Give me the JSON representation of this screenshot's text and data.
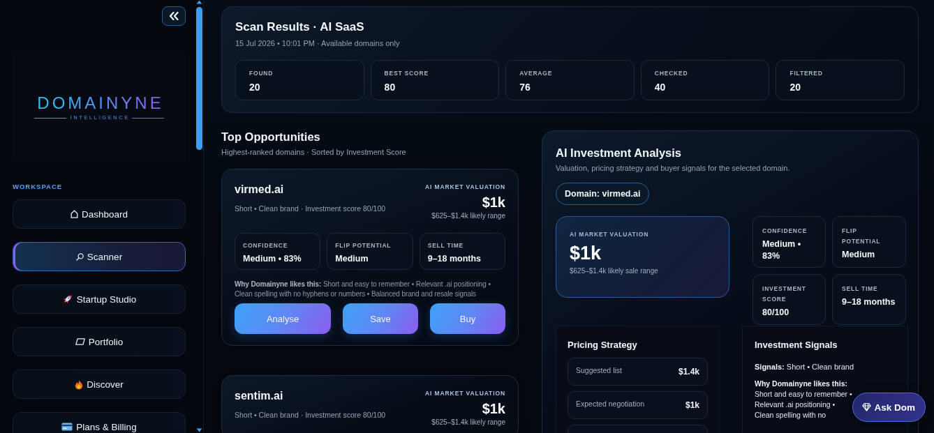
{
  "sidebar": {
    "logo": {
      "wordmark": "DOMAINYNE",
      "tagline": "INTELLIGENCE"
    },
    "section": "WORKSPACE",
    "items": [
      {
        "label": "Dashboard",
        "selected": false
      },
      {
        "label": "Scanner",
        "selected": true
      },
      {
        "label": "Startup Studio",
        "selected": false
      },
      {
        "label": "Portfolio",
        "selected": false
      },
      {
        "label": "Discover",
        "selected": false
      },
      {
        "label": "Plans & Billing",
        "selected": false
      }
    ]
  },
  "scan_results": {
    "title": "Scan Results · AI SaaS",
    "subtitle": "15 Jul 2026 • 10:01 PM · Available domains only",
    "stats": [
      {
        "label": "FOUND",
        "value": "20"
      },
      {
        "label": "BEST SCORE",
        "value": "80"
      },
      {
        "label": "AVERAGE",
        "value": "76"
      },
      {
        "label": "CHECKED",
        "value": "40"
      },
      {
        "label": "FILTERED",
        "value": "20"
      }
    ]
  },
  "top_opportunities": {
    "title": "Top Opportunities",
    "subtitle": "Highest-ranked domains · Sorted by Investment Score",
    "cards": [
      {
        "domain": "virmed.ai",
        "summary": "Short • Clean brand · Investment score 80/100",
        "valuation_label": "AI MARKET VALUATION",
        "valuation": "$1k",
        "range": "$625–$1.4k likely range",
        "metrics": [
          {
            "label": "CONFIDENCE",
            "value": "Medium • 83%"
          },
          {
            "label": "FLIP POTENTIAL",
            "value": "Medium"
          },
          {
            "label": "SELL TIME",
            "value": "9–18 months"
          }
        ],
        "reason": "**Why Domainyne likes this:** Short and easy to remember • Relevant .ai positioning • Clean spelling with no hyphens or numbers • Balanced brand and resale signals",
        "actions": [
          "Analyse",
          "Save",
          "Buy"
        ]
      },
      {
        "domain": "sentim.ai",
        "summary": "Short • Clean brand · Investment score 80/100",
        "valuation_label": "AI MARKET VALUATION",
        "valuation": "$1k",
        "range": "$625–$1.4k likely range"
      }
    ]
  },
  "analysis": {
    "title": "AI Investment Analysis",
    "subtitle": "Valuation, pricing strategy and buyer signals for the selected domain.",
    "domain": "Domain: virmed.ai",
    "valuation": {
      "label": "AI MARKET VALUATION",
      "value": "$1k",
      "range": "$625–$1.4k likely sale range"
    },
    "metrics": [
      {
        "label": "CONFIDENCE",
        "value": "Medium • 83%"
      },
      {
        "label": "FLIP POTENTIAL",
        "value": "Medium"
      },
      {
        "label": "INVESTMENT SCORE",
        "value": "80/100"
      },
      {
        "label": "SELL TIME",
        "value": "9–18 months"
      }
    ],
    "pricing": {
      "title": "Pricing Strategy",
      "rows": [
        {
          "label": "Suggested list",
          "value": "$1.4k"
        },
        {
          "label": "Expected negotiation",
          "value": "$1k"
        },
        {}
      ]
    },
    "signals": {
      "title": "Investment Signals",
      "summary": "**Signals:** Short • Clean brand",
      "reason": "**Why Domainyne likes this:** Short and easy to remember • Relevant .ai positioning • Clean spelling with no"
    }
  },
  "ask_button": {
    "label": "Ask Dom"
  }
}
